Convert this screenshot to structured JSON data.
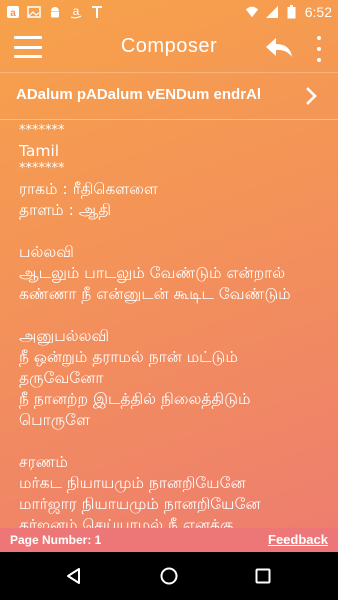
{
  "status_bar": {
    "time": "6:52",
    "left_icons": [
      "amazon-a-icon",
      "gallery-icon",
      "android-icon",
      "amazon-icon",
      "tamil-t-icon"
    ],
    "right_icons": [
      "wifi-icon",
      "signal-icon",
      "battery-icon"
    ]
  },
  "app_bar": {
    "title": "Composer"
  },
  "song": {
    "title": "ADalum pADalum vENDum endrAl"
  },
  "lyrics": [
    {
      "text": "*******",
      "kind": "stars"
    },
    {
      "text": "Tamil",
      "kind": "line"
    },
    {
      "text": "*******",
      "kind": "stars"
    },
    {
      "text": "ராகம் : ரீதிகௌளை",
      "kind": "line"
    },
    {
      "text": "தாளம் : ஆதி",
      "kind": "line"
    },
    {
      "text": "",
      "kind": "blank"
    },
    {
      "text": "பல்லவி",
      "kind": "line"
    },
    {
      "text": "ஆடலும் பாடலும் வேண்டும் என்றால்",
      "kind": "line"
    },
    {
      "text": "கண்ணா நீ என்னுடன் கூடிட வேண்டும்",
      "kind": "line"
    },
    {
      "text": "",
      "kind": "blank"
    },
    {
      "text": "அனுபல்லவி",
      "kind": "line"
    },
    {
      "text": "நீ ஒன்றும் தராமல் நான் மட்டும்",
      "kind": "line"
    },
    {
      "text": "தருவேனோ",
      "kind": "line"
    },
    {
      "text": "நீ நானற்ற இடத்தில் நிலைத்திடும்",
      "kind": "line"
    },
    {
      "text": "பொருளே",
      "kind": "line"
    },
    {
      "text": "",
      "kind": "blank"
    },
    {
      "text": "சரணம்",
      "kind": "line"
    },
    {
      "text": "மர்கட நியாயமும் நானறியேனே",
      "kind": "line"
    },
    {
      "text": "மார்ஜார நியாயமும் நானறியேனே",
      "kind": "line"
    },
    {
      "text": "கர்ஜனம் செய்யாமல் நீ எனக்கு",
      "kind": "line"
    }
  ],
  "footer": {
    "page_number": "Page Number: 1",
    "feedback": "Feedback"
  },
  "nav_bar": {
    "buttons": [
      "back-triangle-icon",
      "home-circle-icon",
      "recents-square-icon"
    ]
  }
}
